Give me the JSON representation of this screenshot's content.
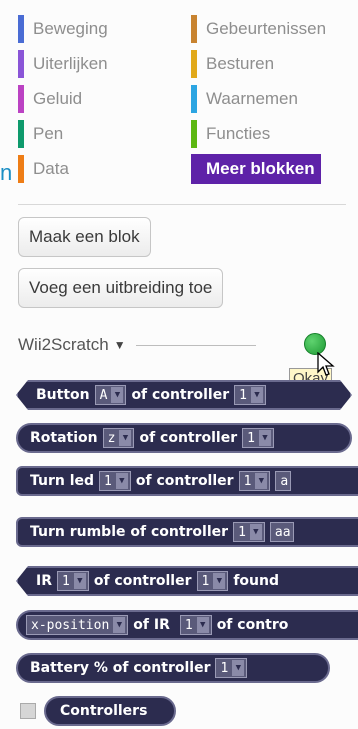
{
  "categories": [
    {
      "label": "Beweging",
      "color": "#4a6cd4"
    },
    {
      "label": "Gebeurtenissen",
      "color": "#c88330"
    },
    {
      "label": "Uiterlijken",
      "color": "#8a55d7"
    },
    {
      "label": "Besturen",
      "color": "#e1a91a"
    },
    {
      "label": "Geluid",
      "color": "#bb42c3"
    },
    {
      "label": "Waarnemen",
      "color": "#2ca5e2"
    },
    {
      "label": "Pen",
      "color": "#0e9a6c"
    },
    {
      "label": "Functies",
      "color": "#5cb712"
    },
    {
      "label": "Data",
      "color": "#ee7d16"
    },
    {
      "label": "Meer blokken",
      "color": "#632d99",
      "selected": true
    }
  ],
  "buttons": {
    "make_block": "Maak een blok",
    "add_extension": "Voeg een uitbreiding toe"
  },
  "extension": {
    "name": "Wii2Scratch",
    "caret": "▼",
    "status_color": "#2ca53c",
    "tooltip": "Okay"
  },
  "blocks": [
    {
      "w1": "Button",
      "d1": "A",
      "w2": "of controller",
      "d2": "1"
    },
    {
      "w1": "Rotation",
      "d1": "z",
      "w2": "of controller",
      "d2": "1"
    },
    {
      "w1": "Turn led",
      "d1": "1",
      "w2": "of controller",
      "d2": "1",
      "d3": "a"
    },
    {
      "w1": "Turn rumble of controller",
      "d1": "1",
      "d2": "aa"
    },
    {
      "w1": "IR",
      "d1": "1",
      "w2": "of controller",
      "d2": "1",
      "w3": "found"
    },
    {
      "d1": "x-position",
      "w1": "of IR",
      "d2": "1",
      "w2": "of contro"
    },
    {
      "w1": "Battery % of controller",
      "d1": "1"
    },
    {
      "w1": "Controllers"
    }
  ]
}
